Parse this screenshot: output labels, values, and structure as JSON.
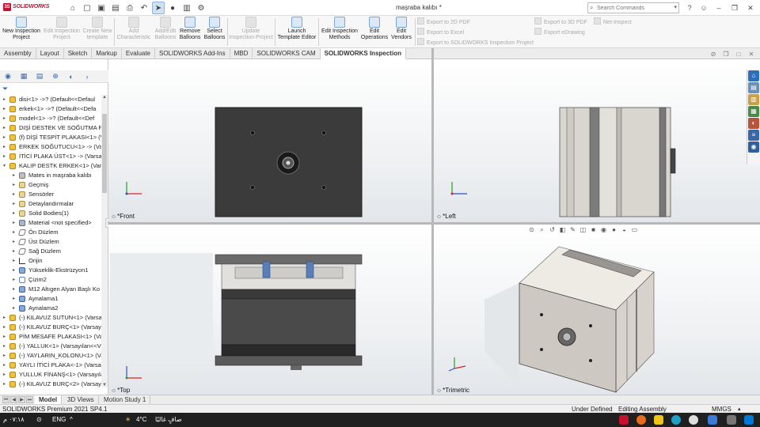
{
  "app": {
    "logo": "SOLIDWORKS",
    "doc_title": "maşraba kalıbı *"
  },
  "search": {
    "placeholder": "Search Commands"
  },
  "ribbon": {
    "buttons": [
      {
        "label": "New Inspection Project",
        "enabled": true
      },
      {
        "label": "Edit Inspection Project",
        "enabled": false
      },
      {
        "label": "Create New template",
        "enabled": false
      },
      {
        "label": "Add Characteristic",
        "enabled": false
      },
      {
        "label": "Add/Edit Balloons",
        "enabled": false
      },
      {
        "label": "Remove Balloons",
        "enabled": true
      },
      {
        "label": "Select Balloons",
        "enabled": true
      },
      {
        "label": "Update Inspection Project",
        "enabled": false
      },
      {
        "label": "Launch Template Editor",
        "enabled": true
      },
      {
        "label": "Edit Inspection Methods",
        "enabled": true
      },
      {
        "label": "Edit Operations",
        "enabled": true
      },
      {
        "label": "Edit Vendors",
        "enabled": true
      }
    ],
    "exports": [
      "Export to 2D PDF",
      "Export to Excel",
      "Export to SOLIDWORKS Inspection Project",
      "Export to 3D PDF",
      "Export eDrawing",
      "Net-Inspect"
    ]
  },
  "tabs": [
    "Assembly",
    "Layout",
    "Sketch",
    "Markup",
    "Evaluate",
    "SOLIDWORKS Add-Ins",
    "MBD",
    "SOLIDWORKS CAM",
    "SOLIDWORKS Inspection"
  ],
  "active_tab": "SOLIDWORKS Inspection",
  "tree": [
    {
      "label": "disi<1> ->? (Default<<Defaul",
      "icon": "asm",
      "level": 0
    },
    {
      "label": "erkek<1> ->? (Default<<Defa",
      "icon": "asm",
      "level": 0
    },
    {
      "label": "model<1> ->? (Default<<Def",
      "icon": "asm",
      "level": 0
    },
    {
      "label": "DIŞİ DESTEK VE SOĞUTMA PL",
      "icon": "asm",
      "level": 0
    },
    {
      "label": "(f) DİŞİ TESPİT PLAKASI<1> (V",
      "icon": "asm",
      "level": 0
    },
    {
      "label": "ERKEK SOĞUTUCU<1> -> (Var",
      "icon": "asm",
      "level": 0
    },
    {
      "label": "İTİCİ PLAKA ÜST<1> -> (Varsa",
      "icon": "asm",
      "level": 0
    },
    {
      "label": "KALIP DESTK ERKEK<1> (Varsa",
      "icon": "asm",
      "level": 0,
      "expanded": true
    },
    {
      "label": "Mates in maşraba kalıbı",
      "icon": "mate",
      "level": 1
    },
    {
      "label": "Geçmiş",
      "icon": "fold",
      "level": 1
    },
    {
      "label": "Sensörler",
      "icon": "fold",
      "level": 1
    },
    {
      "label": "Detaylandırmalar",
      "icon": "fold",
      "level": 1
    },
    {
      "label": "Solid Bodies(1)",
      "icon": "fold",
      "level": 1
    },
    {
      "label": "Material <not specified>",
      "icon": "mat",
      "level": 1
    },
    {
      "label": "Ön Düzlem",
      "icon": "plane",
      "level": 1
    },
    {
      "label": "Üst Düzlem",
      "icon": "plane",
      "level": 1
    },
    {
      "label": "Sağ Düzlem",
      "icon": "plane",
      "level": 1
    },
    {
      "label": "Orijin",
      "icon": "orig",
      "level": 1
    },
    {
      "label": "Yükseklik-Ekstrüzyon1",
      "icon": "feat",
      "level": 1
    },
    {
      "label": "Çizim2",
      "icon": "sk",
      "level": 1
    },
    {
      "label": "M12 Altıgen Alyan Başlı Ko",
      "icon": "feat",
      "level": 1
    },
    {
      "label": "Aynalama1",
      "icon": "feat",
      "level": 1
    },
    {
      "label": "Aynalama2",
      "icon": "feat",
      "level": 1
    },
    {
      "label": "(-) KILAVUZ SUTUN<1> (Varsa",
      "icon": "asm",
      "level": 0
    },
    {
      "label": "(-) KILAVUZ BURÇ<1> (Varsay",
      "icon": "asm",
      "level": 0
    },
    {
      "label": "PİM MESAFE PLAKASI<1> (Var",
      "icon": "asm",
      "level": 0
    },
    {
      "label": "(-) YALLUK<1> (Varsayılan<<V",
      "icon": "asm",
      "level": 0
    },
    {
      "label": "(-) YAYLARIN_KOLONU<1> (Va",
      "icon": "asm",
      "level": 0
    },
    {
      "label": "YAYLI İTİCİ PLAKA<-1> (Varsayı",
      "icon": "asm",
      "level": 0
    },
    {
      "label": "YULLUK FİNANŞ<1> (Varsayıla",
      "icon": "asm",
      "level": 0
    },
    {
      "label": "(-) KILAVUZ BURÇ<2> (Varsay",
      "icon": "asm",
      "level": 0
    }
  ],
  "viewports": {
    "front": "*Front",
    "left": "*Left",
    "top": "*Top",
    "trimetric": "*Trimetric"
  },
  "bottom_tabs": [
    "Model",
    "3D Views",
    "Motion Study 1"
  ],
  "active_bottom_tab": "Model",
  "status": {
    "version": "SOLIDWORKS Premium 2021 SP4.1",
    "state": "Under Defined",
    "mode": "Editing Assembly",
    "units": "MMGS"
  },
  "taskbar": {
    "time": "٠٧:١٨ م",
    "lang": "ENG",
    "weather": "4°C",
    "weather_text": "صافٍ غالبًا"
  },
  "colors": {
    "plate_dark": "#3a3a3a",
    "plate_light": "#d9d5cf",
    "accent_red": "#c8102e",
    "ribbon_bg": "#f7f7f7"
  }
}
